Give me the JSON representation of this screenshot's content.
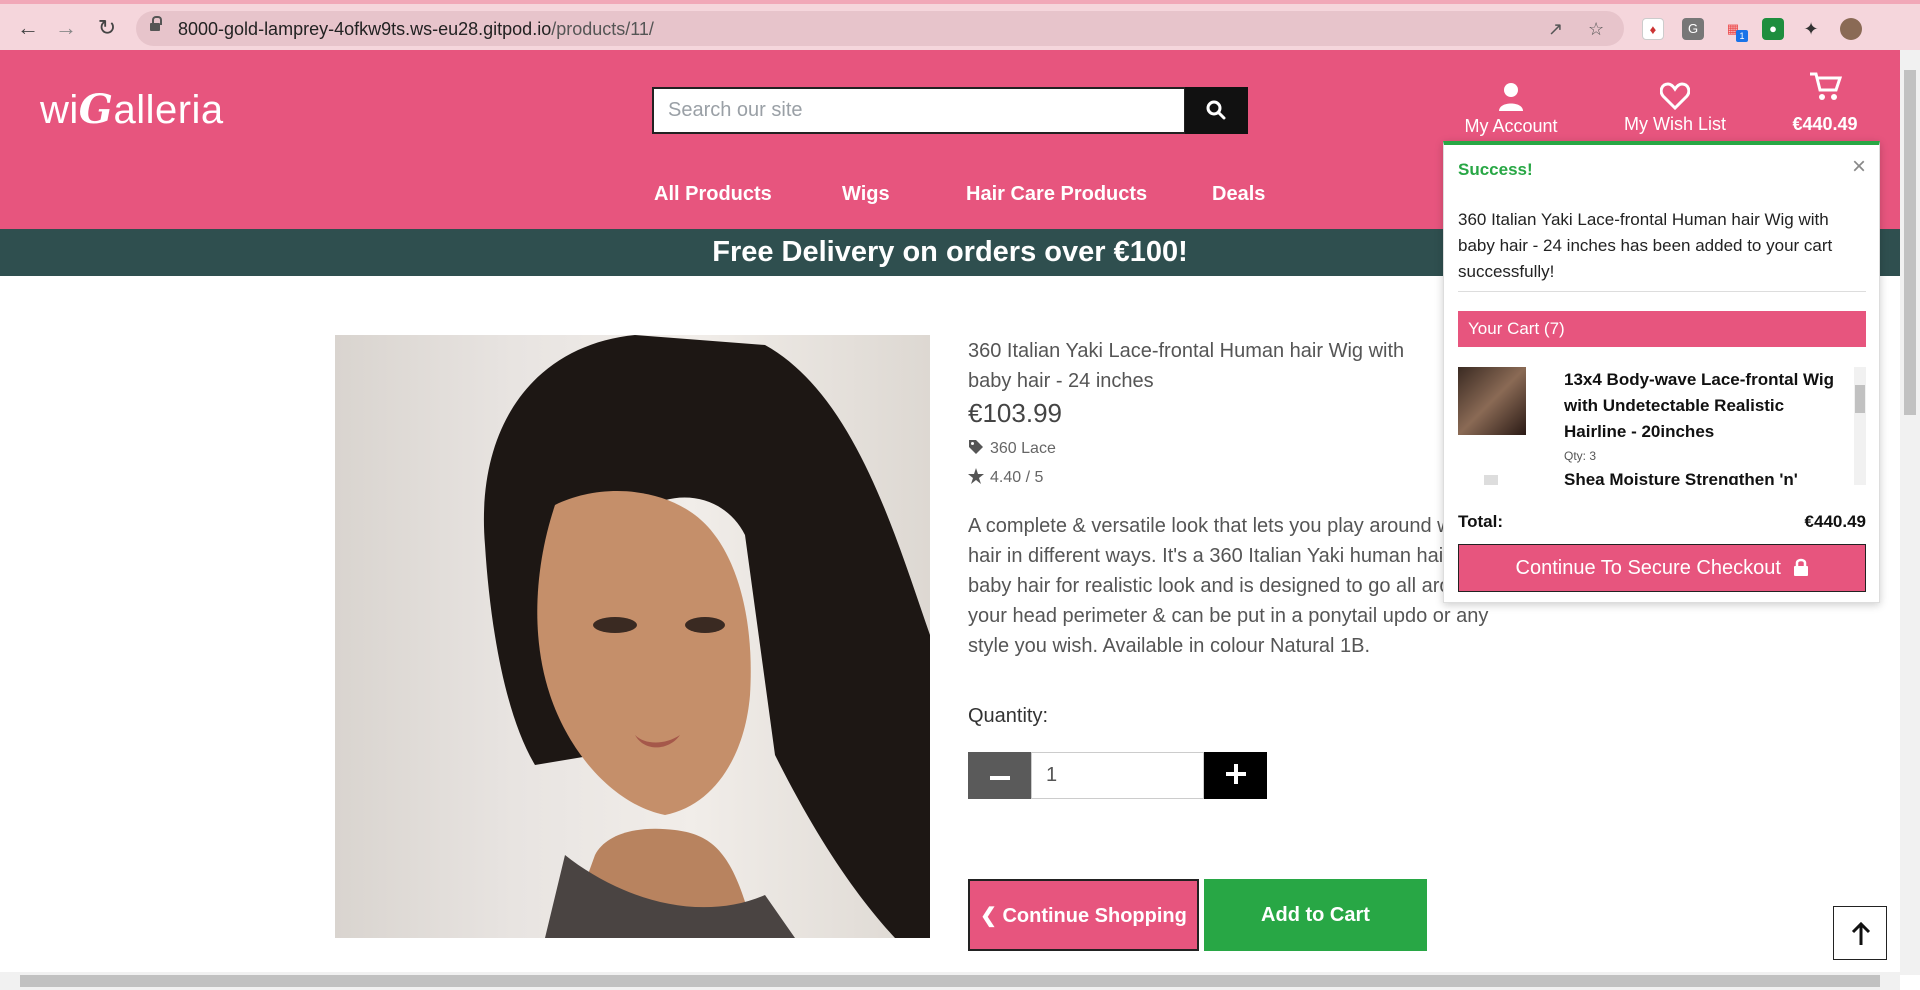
{
  "browser": {
    "url_host": "8000-gold-lamprey-4ofkw9ts.ws-eu28.gitpod.io",
    "url_path": "/products/11/",
    "extension_badge": "1"
  },
  "header": {
    "logo_prefix": "wi",
    "logo_g": "G",
    "logo_suffix": "alleria",
    "search_placeholder": "Search our site",
    "account_label": "My Account",
    "wishlist_label": "My Wish List",
    "cart_total": "€440.49"
  },
  "nav": {
    "items": [
      "All Products",
      "Wigs",
      "Hair Care Products",
      "Deals"
    ]
  },
  "promo": "Free Delivery on orders over €100!",
  "product": {
    "title": "360 Italian Yaki Lace-frontal Human hair Wig with baby hair - 24 inches",
    "price": "€103.99",
    "category": "360 Lace",
    "rating": "4.40 / 5",
    "description": "A complete & versatile look that lets you play around with your hair in different ways. It's a 360 Italian Yaki human hair wig with baby hair for realistic look and is designed to go all around your head perimeter & can be put in a ponytail updo or any style you wish. Available in colour Natural 1B.",
    "quantity_label": "Quantity:",
    "quantity_value": "1",
    "continue_label": "Continue Shopping",
    "add_label": "Add to Cart"
  },
  "toast": {
    "title": "Success!",
    "message": "360 Italian Yaki Lace-frontal Human hair Wig with baby hair - 24 inches has been added to your cart successfully!",
    "cart_header": "Your Cart (7)",
    "items": [
      {
        "name": "13x4 Body-wave Lace-frontal Wig with Undetectable Realistic Hairline - 20inches",
        "qty": "Qty: 3"
      },
      {
        "name": "Shea Moisture Strengthen 'n'"
      }
    ],
    "total_label": "Total:",
    "total_value": "€440.49",
    "checkout_label": "Continue To Secure Checkout"
  },
  "colors": {
    "brand_pink": "#e7557e",
    "promo_bg": "#2f4f4f",
    "success_green": "#28a745"
  }
}
